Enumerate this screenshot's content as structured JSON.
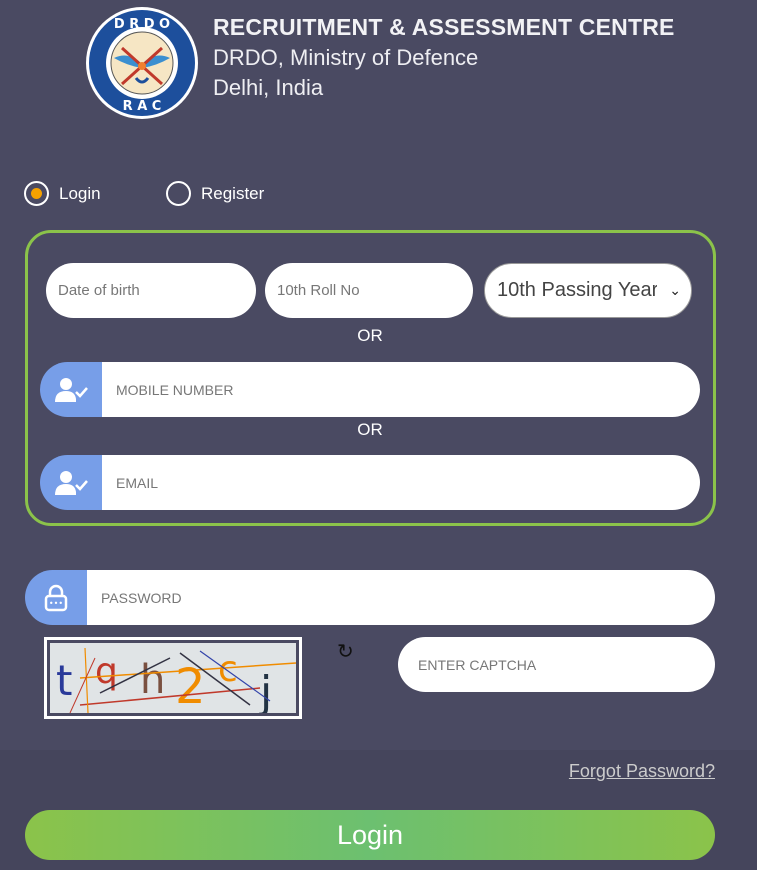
{
  "header": {
    "title": "RECRUITMENT & ASSESSMENT CENTRE",
    "line2": "DRDO, Ministry of Defence",
    "line3": "Delhi, India",
    "logo_text": "DRDO RAC"
  },
  "mode": {
    "login": "Login",
    "register": "Register",
    "selected": "login"
  },
  "form": {
    "dob_placeholder": "Date of birth",
    "roll_placeholder": "10th Roll No",
    "year_select": "10th Passing Year",
    "or1": "OR",
    "mobile_placeholder": "MOBILE NUMBER",
    "or2": "OR",
    "email_placeholder": "EMAIL",
    "password_placeholder": "PASSWORD",
    "captcha_image_text": "tqh2cj",
    "captcha_placeholder": "ENTER CAPTCHA",
    "forgot": "Forgot Password?",
    "login_button": "Login"
  },
  "colors": {
    "accent": "#8bc34a",
    "radio": "#f5a100",
    "icon_bg": "#779ee8"
  }
}
